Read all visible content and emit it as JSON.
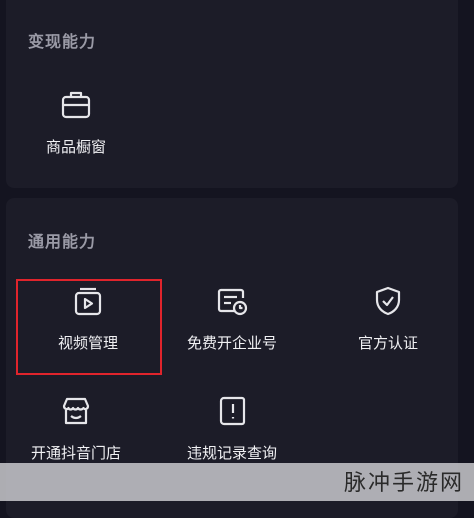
{
  "sections": {
    "monetize": {
      "title": "变现能力",
      "items": [
        {
          "label": "商品橱窗",
          "icon": "briefcase-icon"
        }
      ]
    },
    "general": {
      "title": "通用能力",
      "items": [
        {
          "label": "视频管理",
          "icon": "video-manage-icon"
        },
        {
          "label": "免费开企业号",
          "icon": "enterprise-account-icon"
        },
        {
          "label": "官方认证",
          "icon": "shield-check-icon"
        },
        {
          "label": "开通抖音门店",
          "icon": "storefront-icon"
        },
        {
          "label": "违规记录查询",
          "icon": "violation-record-icon"
        }
      ]
    }
  },
  "watermark": "脉冲手游网",
  "colors": {
    "highlight": "#e0242c",
    "background": "#141420",
    "card": "#1c1c28"
  }
}
